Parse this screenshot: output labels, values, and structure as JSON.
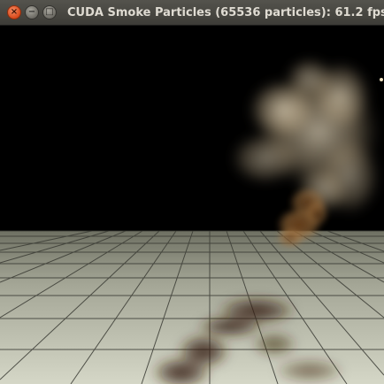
{
  "window": {
    "title": "CUDA Smoke Particles (65536 particles): 61.2 fps",
    "controls": {
      "close_glyph": "×",
      "minimize_glyph": "−",
      "maximize_glyph": "□"
    }
  },
  "scene": {
    "smoke_color": "#d9c7a6",
    "floor_color": "#c9cbb9",
    "shadow_color": "#3a230f"
  }
}
